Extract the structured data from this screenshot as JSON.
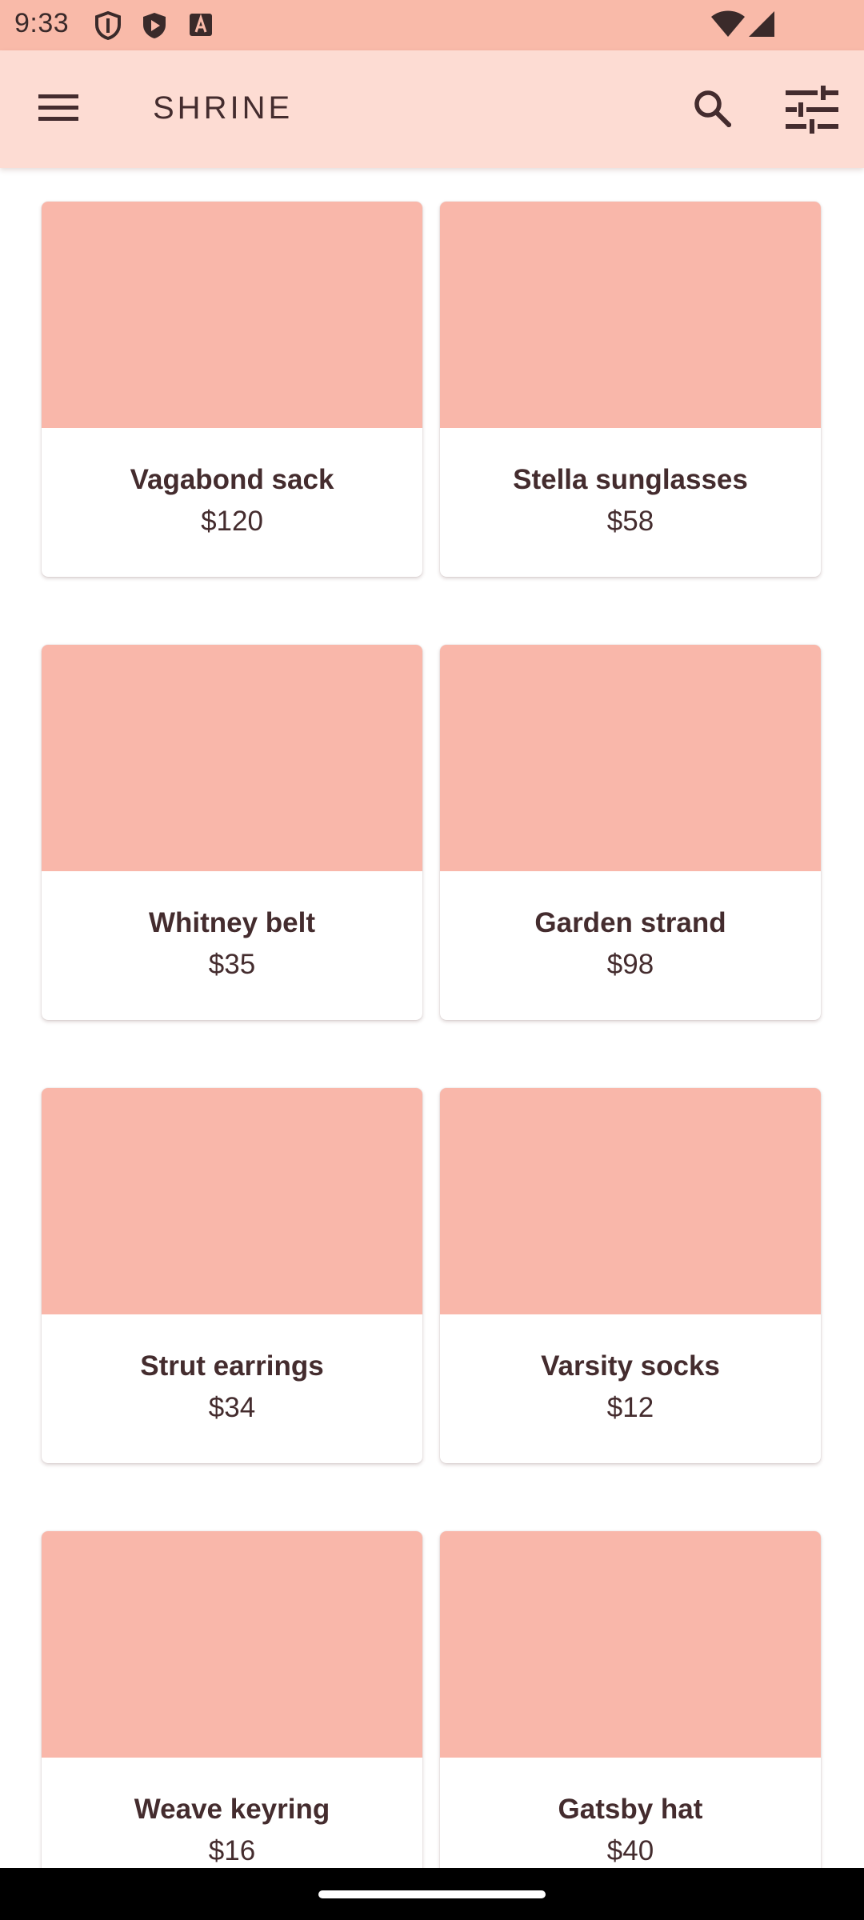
{
  "status_bar": {
    "time": "9:33",
    "background": "#f9baa9",
    "icons": [
      "shield-icon",
      "play-protect-icon",
      "text-a-icon",
      "wifi-icon",
      "cell-signal-icon"
    ]
  },
  "app_bar": {
    "title": "SHRINE",
    "background": "#fddcd3",
    "icons": [
      "menu-icon",
      "search-icon",
      "tune-icon"
    ]
  },
  "colors": {
    "accent": "#442c2e",
    "card_image": "#f9b7aa",
    "card_background": "#ffffff"
  },
  "products": [
    {
      "name": "Vagabond sack",
      "price": "$120"
    },
    {
      "name": "Stella sunglasses",
      "price": "$58"
    },
    {
      "name": "Whitney belt",
      "price": "$35"
    },
    {
      "name": "Garden strand",
      "price": "$98"
    },
    {
      "name": "Strut earrings",
      "price": "$34"
    },
    {
      "name": "Varsity socks",
      "price": "$12"
    },
    {
      "name": "Weave keyring",
      "price": "$16"
    },
    {
      "name": "Gatsby hat",
      "price": "$40"
    }
  ]
}
